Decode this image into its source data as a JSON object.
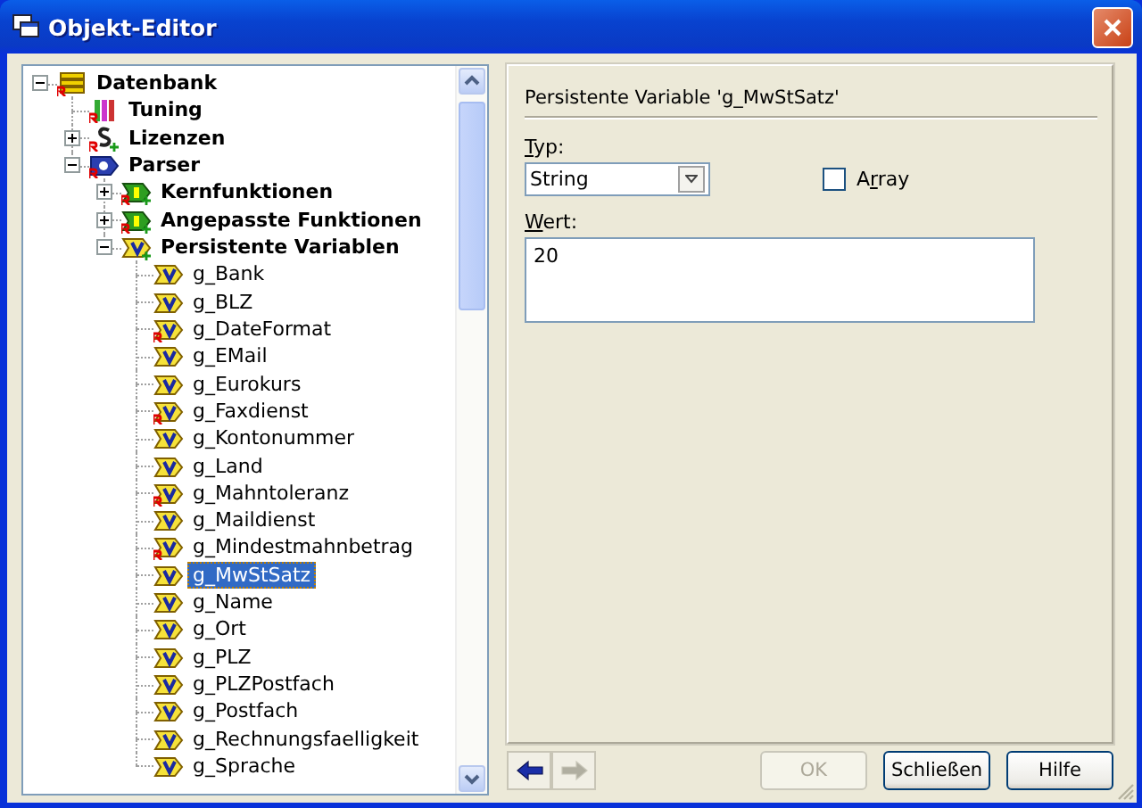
{
  "window": {
    "title": "Objekt-Editor"
  },
  "tree": [
    {
      "label": "Datenbank",
      "kind": "database",
      "restricted": true,
      "added": false,
      "expanded": true,
      "selected": false,
      "children": [
        {
          "label": "Tuning",
          "kind": "tuning",
          "restricted": true,
          "added": false,
          "selected": false
        },
        {
          "label": "Lizenzen",
          "kind": "license",
          "restricted": true,
          "added": true,
          "expanded": false,
          "selected": false
        },
        {
          "label": "Parser",
          "kind": "parser",
          "restricted": true,
          "added": false,
          "expanded": true,
          "selected": false,
          "children": [
            {
              "label": "Kernfunktionen",
              "kind": "function",
              "restricted": true,
              "added": true,
              "expanded": false,
              "selected": false
            },
            {
              "label": "Angepasste Funktionen",
              "kind": "function",
              "restricted": true,
              "added": true,
              "expanded": false,
              "selected": false
            },
            {
              "label": "Persistente Variablen",
              "kind": "variable",
              "restricted": false,
              "added": true,
              "expanded": true,
              "selected": false,
              "children": [
                {
                  "label": "g_Bank",
                  "kind": "variable",
                  "restricted": false,
                  "added": false,
                  "selected": false
                },
                {
                  "label": "g_BLZ",
                  "kind": "variable",
                  "restricted": false,
                  "added": false,
                  "selected": false
                },
                {
                  "label": "g_DateFormat",
                  "kind": "variable",
                  "restricted": true,
                  "added": false,
                  "selected": false
                },
                {
                  "label": "g_EMail",
                  "kind": "variable",
                  "restricted": false,
                  "added": false,
                  "selected": false
                },
                {
                  "label": "g_Eurokurs",
                  "kind": "variable",
                  "restricted": false,
                  "added": false,
                  "selected": false
                },
                {
                  "label": "g_Faxdienst",
                  "kind": "variable",
                  "restricted": true,
                  "added": false,
                  "selected": false
                },
                {
                  "label": "g_Kontonummer",
                  "kind": "variable",
                  "restricted": false,
                  "added": false,
                  "selected": false
                },
                {
                  "label": "g_Land",
                  "kind": "variable",
                  "restricted": false,
                  "added": false,
                  "selected": false
                },
                {
                  "label": "g_Mahntoleranz",
                  "kind": "variable",
                  "restricted": true,
                  "added": false,
                  "selected": false
                },
                {
                  "label": "g_Maildienst",
                  "kind": "variable",
                  "restricted": false,
                  "added": false,
                  "selected": false
                },
                {
                  "label": "g_Mindestmahnbetrag",
                  "kind": "variable",
                  "restricted": true,
                  "added": false,
                  "selected": false
                },
                {
                  "label": "g_MwStSatz",
                  "kind": "variable",
                  "restricted": false,
                  "added": false,
                  "selected": true
                },
                {
                  "label": "g_Name",
                  "kind": "variable",
                  "restricted": false,
                  "added": false,
                  "selected": false
                },
                {
                  "label": "g_Ort",
                  "kind": "variable",
                  "restricted": false,
                  "added": false,
                  "selected": false
                },
                {
                  "label": "g_PLZ",
                  "kind": "variable",
                  "restricted": false,
                  "added": false,
                  "selected": false
                },
                {
                  "label": "g_PLZPostfach",
                  "kind": "variable",
                  "restricted": false,
                  "added": false,
                  "selected": false
                },
                {
                  "label": "g_Postfach",
                  "kind": "variable",
                  "restricted": false,
                  "added": false,
                  "selected": false
                },
                {
                  "label": "g_Rechnungsfaelligkeit",
                  "kind": "variable",
                  "restricted": false,
                  "added": false,
                  "selected": false
                },
                {
                  "label": "g_Sprache",
                  "kind": "variable",
                  "restricted": false,
                  "added": false,
                  "selected": false
                }
              ]
            }
          ]
        }
      ]
    }
  ],
  "editor": {
    "heading": "Persistente Variable 'g_MwStSatz'",
    "type_label": {
      "underlined": "T",
      "after": "yp:"
    },
    "type_value": "String",
    "array_checkbox": {
      "before": "A",
      "underlined": "r",
      "after": "ray",
      "checked": false
    },
    "value_label": {
      "underlined": "W",
      "after": "ert:"
    },
    "value": "20"
  },
  "navigation": [
    {
      "kind": "back",
      "disabled": false
    },
    {
      "kind": "forward",
      "disabled": true
    }
  ],
  "buttons": [
    {
      "label": "OK",
      "disabled": true
    },
    {
      "label": "Schließen",
      "disabled": false
    },
    {
      "label": "Hilfe",
      "disabled": false
    }
  ]
}
